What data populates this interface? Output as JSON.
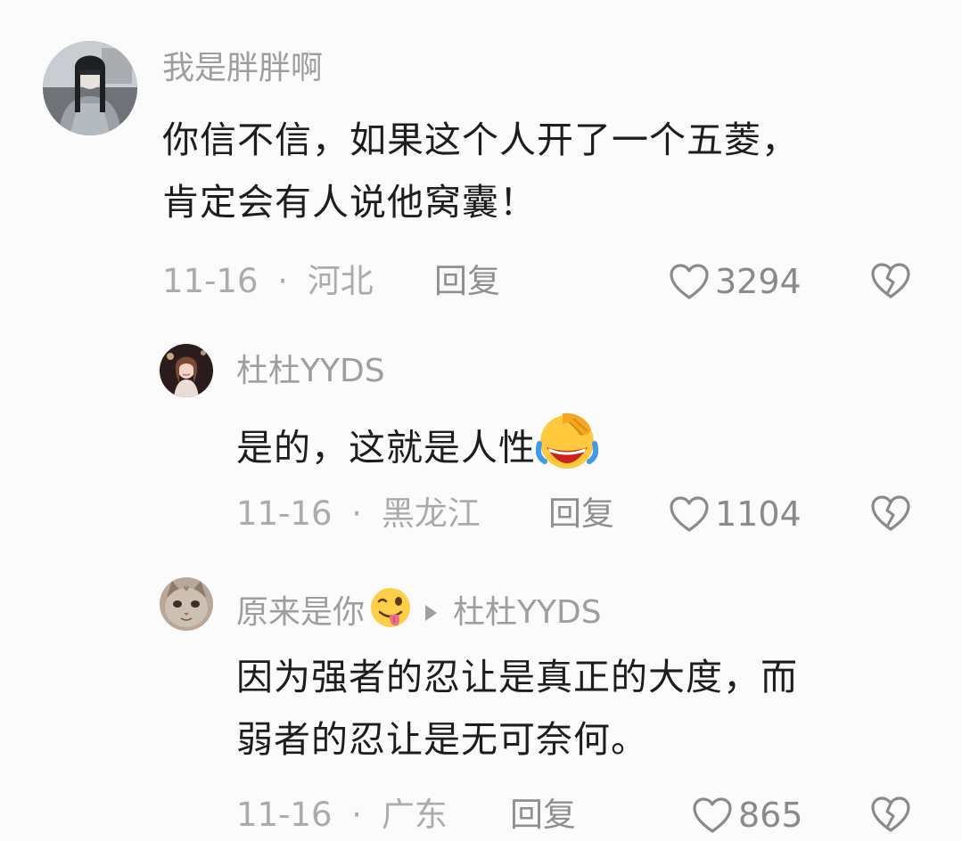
{
  "comments": [
    {
      "username": "我是胖胖啊",
      "avatar_icon": "avatar-person-braids",
      "lines": [
        "你信不信，如果这个人开了一个五菱，",
        "肯定会有人说他窝囊！"
      ],
      "date": "11-16",
      "separator": "·",
      "location": "河北",
      "reply_label": "回复",
      "likes": "3294"
    },
    {
      "username": "杜杜YYDS",
      "avatar_icon": "avatar-woman-portrait",
      "lines": [
        "是的，这就是人性"
      ],
      "trailing_emoji": "facepalm-laugh-emoji",
      "date": "11-16",
      "separator": "·",
      "location": "黑龙江",
      "reply_label": "回复",
      "likes": "1104"
    },
    {
      "username": "原来是你",
      "username_emoji": "tongue-wink-emoji",
      "reply_to": "杜杜YYDS",
      "avatar_icon": "avatar-cat",
      "lines": [
        "因为强者的忍让是真正的大度，而",
        "弱者的忍让是无可奈何。"
      ],
      "date": "11-16",
      "separator": "·",
      "location": "广东",
      "reply_label": "回复",
      "likes": "865"
    }
  ],
  "icons": {
    "like": "heart-outline-icon",
    "dislike": "broken-heart-icon"
  },
  "colors": {
    "background": "#fbfbfb",
    "username": "#9e9e9e",
    "body": "#1d1d1d",
    "meta": "#ababab",
    "icon": "#8a8a8a",
    "emoji_yellow": "#ffc83d"
  }
}
